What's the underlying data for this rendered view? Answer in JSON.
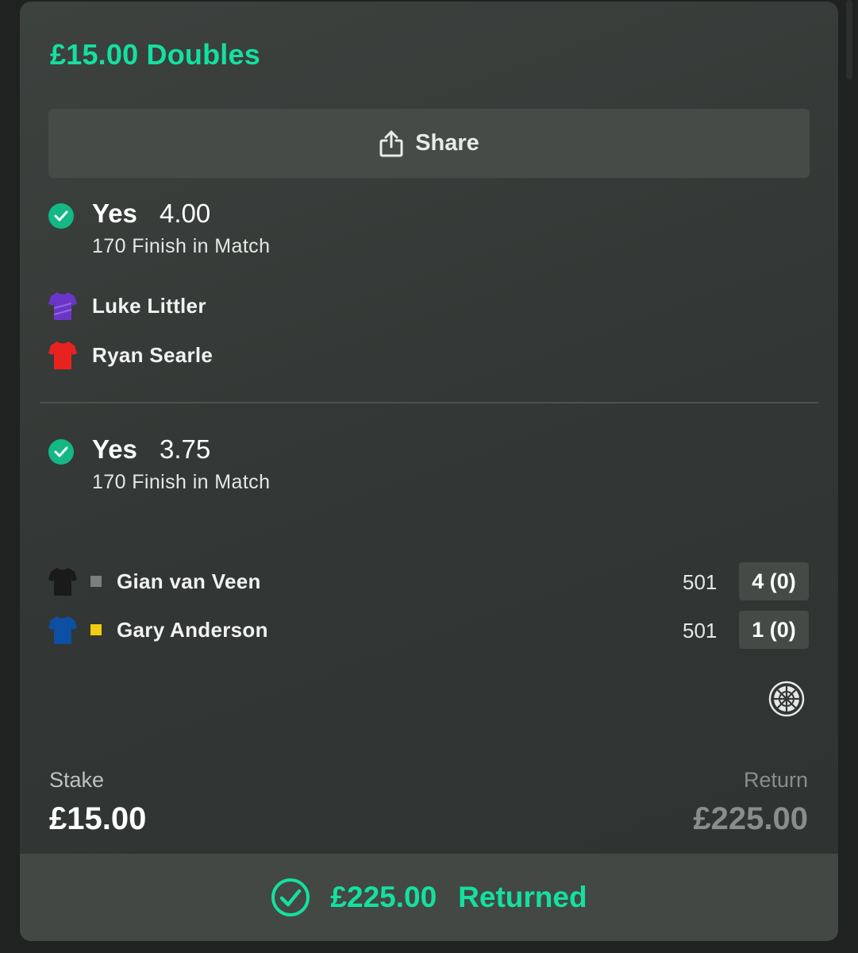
{
  "bet": {
    "title": "£15.00 Doubles",
    "share_label": "Share"
  },
  "selections": [
    {
      "name": "Yes",
      "odds": "4.00",
      "market": "170 Finish in Match",
      "players": [
        {
          "name": "Luke Littler",
          "shirt_color": "#6b35c9"
        },
        {
          "name": "Ryan Searle",
          "shirt_color": "#e8231f"
        }
      ]
    },
    {
      "name": "Yes",
      "odds": "3.75",
      "market": "170 Finish in Match",
      "players": [
        {
          "name": "Gian van Veen",
          "shirt_color": "#1a1a1a",
          "marker_color": "#7c7f7d",
          "start_score": "501",
          "legs": "4 (0)"
        },
        {
          "name": "Gary Anderson",
          "shirt_color": "#0d4fa3",
          "marker_color": "#f2cc10",
          "start_score": "501",
          "legs": "1 (0)"
        }
      ]
    }
  ],
  "summary": {
    "stake_label": "Stake",
    "stake_value": "£15.00",
    "return_label": "Return",
    "return_value": "£225.00"
  },
  "footer": {
    "amount": "£225.00",
    "status": "Returned"
  },
  "colors": {
    "accent": "#14e0a0",
    "check": "#13b884"
  },
  "icons": [
    "share-icon",
    "check-icon",
    "shirt-icon",
    "dartboard-icon",
    "check-circle-icon"
  ]
}
